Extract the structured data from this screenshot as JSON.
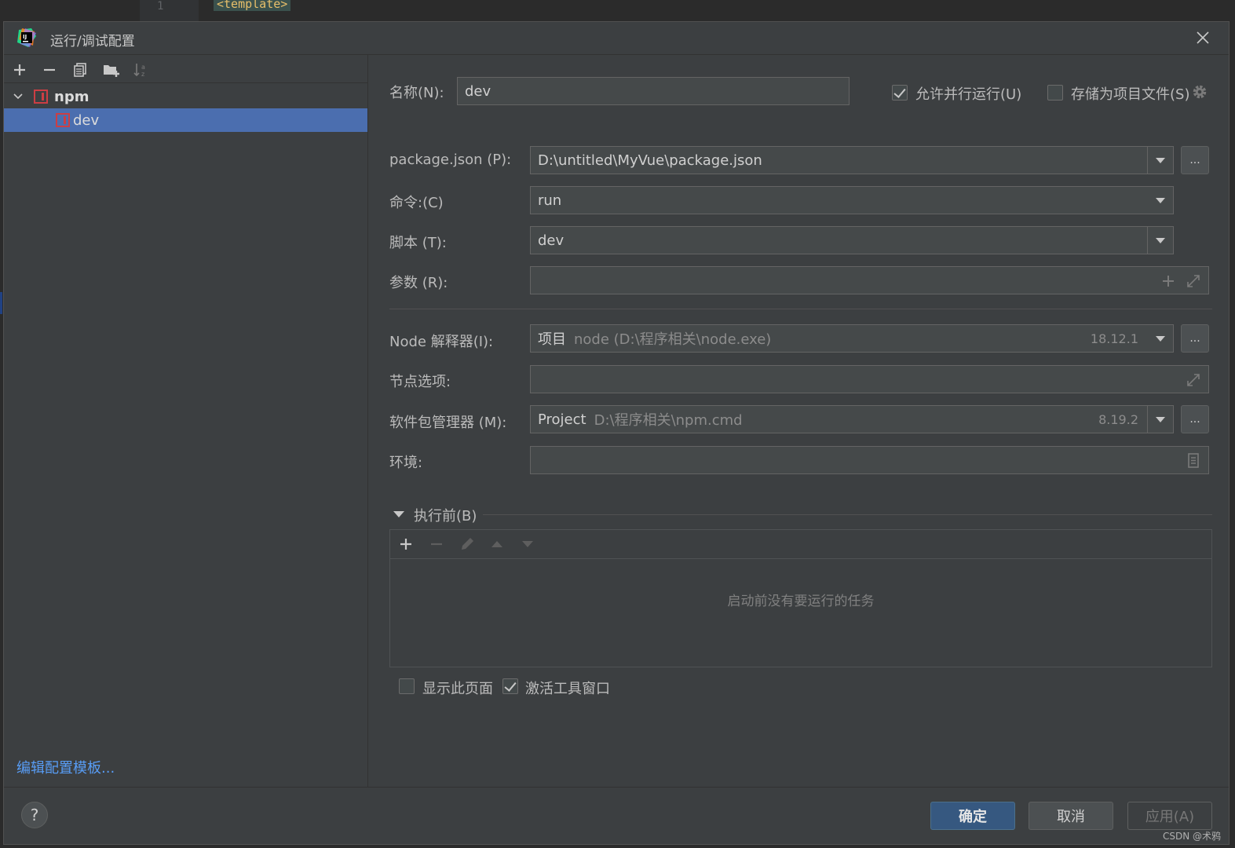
{
  "editor": {
    "line_number": "1",
    "code_text": "<template>"
  },
  "dialog": {
    "title": "运行/调试配置"
  },
  "left": {
    "toolbar": [
      "add-icon",
      "remove-icon",
      "copy-icon",
      "new-folder-icon",
      "sort-icon"
    ],
    "tree": {
      "group_label": "npm",
      "child_label": "dev"
    },
    "edit_templates_link": "编辑配置模板..."
  },
  "form": {
    "name_label": "名称(N):",
    "name_value": "dev",
    "allow_parallel_label": "允许并行运行(U)",
    "allow_parallel_checked": true,
    "store_as_file_label": "存储为项目文件(S)",
    "store_as_file_checked": false,
    "package_json_label": "package.json (P):",
    "package_json_value": "D:\\untitled\\MyVue\\package.json",
    "command_label": "命令:(C)",
    "command_value": "run",
    "script_label": "脚本 (T):",
    "script_value": "dev",
    "args_label": "参数 (R):",
    "args_value": "",
    "node_label": "Node 解释器(I):",
    "node_prefix": "项目",
    "node_path": "node (D:\\程序相关\\node.exe)",
    "node_version": "18.12.1",
    "node_options_label": "节点选项:",
    "node_options_value": "",
    "pkg_manager_label": "软件包管理器 (M):",
    "pkg_manager_prefix": "Project",
    "pkg_manager_path": "D:\\程序相关\\npm.cmd",
    "pkg_manager_version": "8.19.2",
    "env_label": "环境:",
    "env_value": "",
    "dots": "...",
    "before_launch_label": "执行前(B)",
    "before_launch_empty": "启动前没有要运行的任务",
    "show_page_label": "显示此页面",
    "show_page_checked": false,
    "activate_tool_label": "激活工具窗口",
    "activate_tool_checked": true
  },
  "footer": {
    "help": "?",
    "ok": "确定",
    "cancel": "取消",
    "apply": "应用(A)",
    "watermark": "CSDN @术鸦"
  },
  "colors": {
    "dialog_bg": "#3c3f41",
    "selection": "#4b6eaf",
    "link": "#589df6",
    "npm_red": "#cc3e44",
    "primary_button": "#365880"
  }
}
